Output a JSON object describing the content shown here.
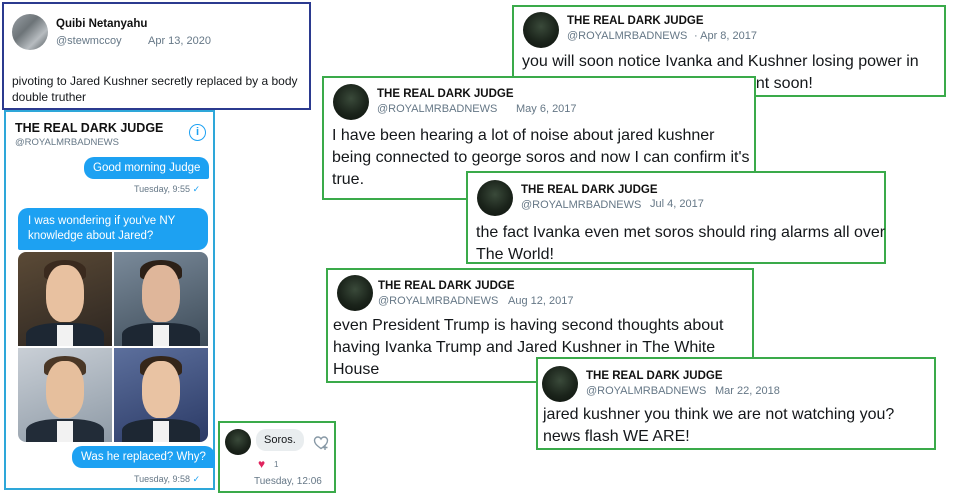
{
  "quibi_tweet": {
    "name": "Quibi Netanyahu",
    "handle": "@stewmccoy",
    "date": "Apr 13, 2020",
    "text": "pivoting to Jared Kushner secretly replaced by a body double truther"
  },
  "dm": {
    "title": "THE REAL DARK JUDGE",
    "handle": "@ROYALMRBADNEWS",
    "info_icon": "info-icon",
    "msg1": "Good morning Judge",
    "meta1": "Tuesday, 9:55",
    "msg2": "I was wondering if you've NY knowledge about Jared?",
    "msg3": "Was he replaced? Why?",
    "meta3": "Tuesday, 9:58",
    "check": "✓"
  },
  "reply": {
    "text": "Soros.",
    "likes": "1",
    "time": "Tuesday, 12:06",
    "heart_icon": "heart-icon",
    "like_add_icon": "like-add-icon"
  },
  "tweets": [
    {
      "name": "THE REAL DARK JUDGE",
      "handle": "@ROYALMRBADNEWS",
      "date": "· Apr 8, 2017",
      "text": "you will soon notice Ivanka and Kushner losing power in The White House and Government soon!"
    },
    {
      "name": "THE REAL DARK JUDGE",
      "handle": "@ROYALMRBADNEWS",
      "date": "May 6, 2017",
      "text": "I have been hearing a lot of noise about jared kushner being connected to george soros and now I can confirm it's true."
    },
    {
      "name": "THE REAL DARK JUDGE",
      "handle": "@ROYALMRBADNEWS",
      "date": "Jul 4, 2017",
      "text": "the fact Ivanka even met soros should ring alarms all over The World!"
    },
    {
      "name": "THE REAL DARK JUDGE",
      "handle": "@ROYALMRBADNEWS",
      "date": "Aug 12, 2017",
      "text": "even President Trump is having second thoughts about having Ivanka Trump and Jared Kushner in The White House"
    },
    {
      "name": "THE REAL DARK JUDGE",
      "handle": "@ROYALMRBADNEWS",
      "date": "Mar 22, 2018",
      "text": "jared kushner you think we are not watching you? news flash WE ARE!"
    }
  ],
  "colors": {
    "accent": "#1da1f2",
    "green_border": "#3aaa4a",
    "navy_border": "#2b3a8f",
    "cyan_border": "#2ea7d9"
  }
}
